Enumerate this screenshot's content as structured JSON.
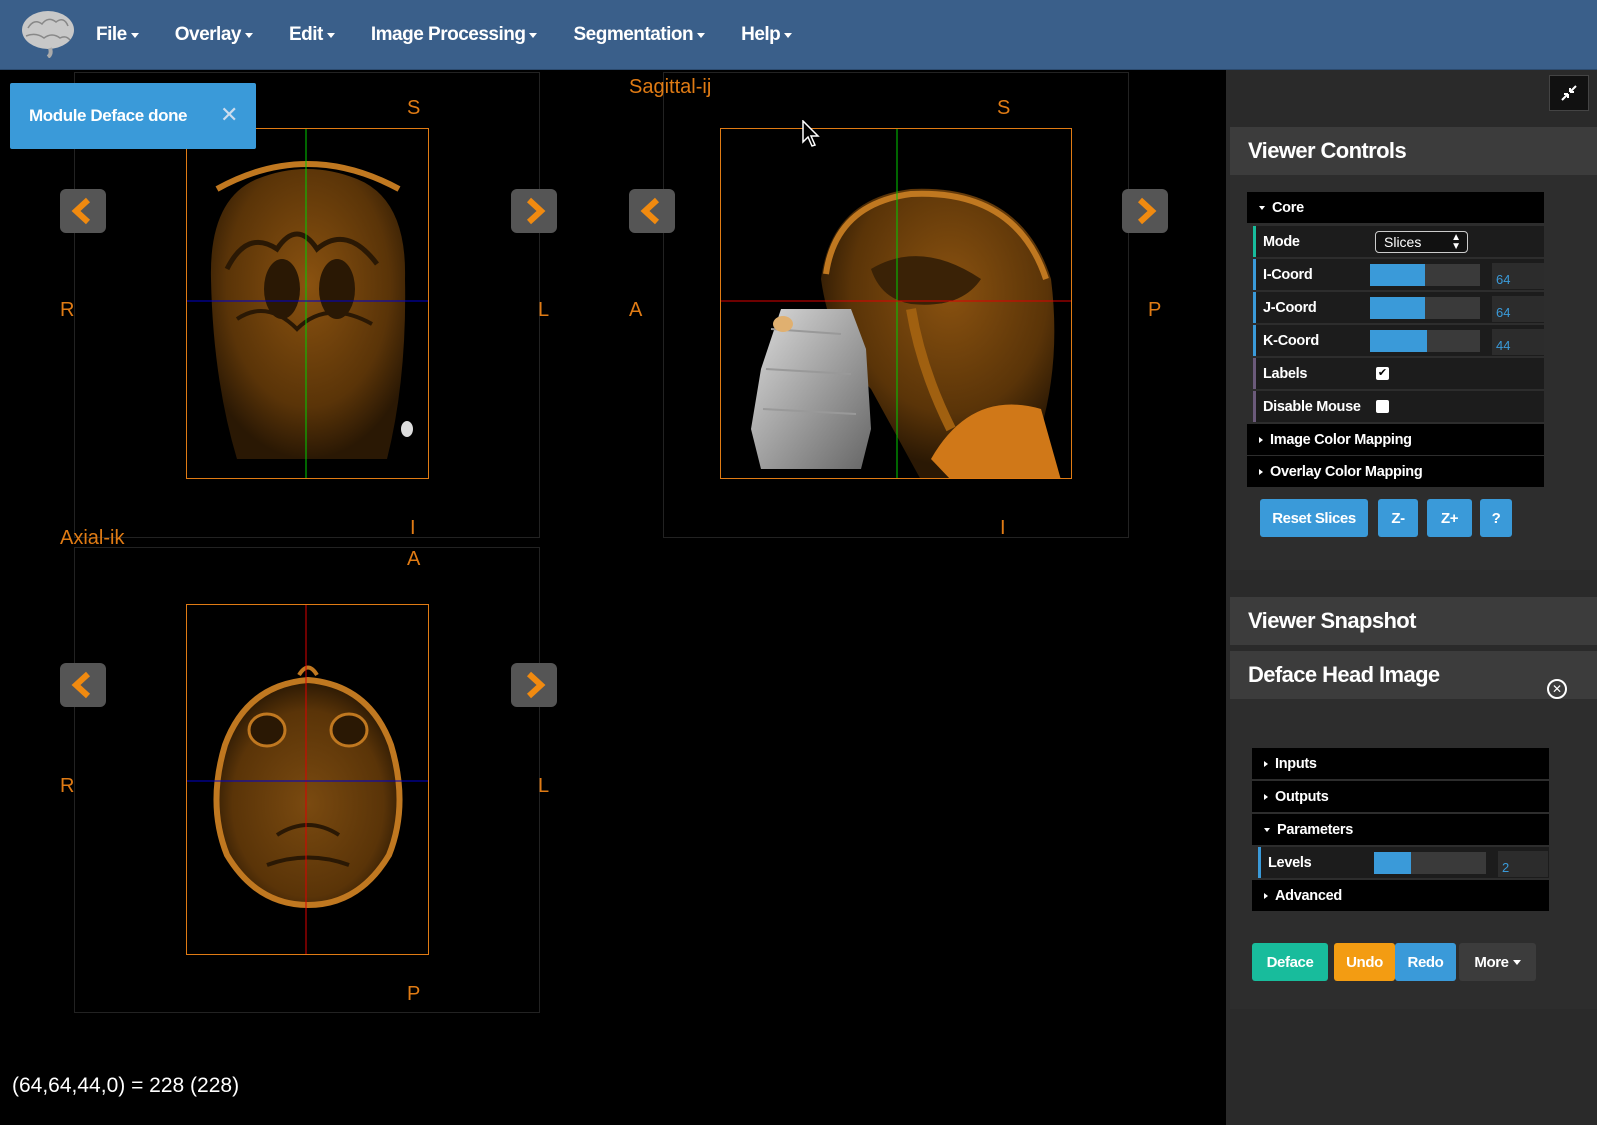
{
  "nav": {
    "logo_icon": "brain-icon",
    "menus": [
      {
        "label": "File"
      },
      {
        "label": "Overlay"
      },
      {
        "label": "Edit"
      },
      {
        "label": "Image Processing"
      },
      {
        "label": "Segmentation"
      },
      {
        "label": "Help"
      }
    ]
  },
  "toast": {
    "message": "Module Deface done",
    "close_label": "✕"
  },
  "views": {
    "coronal": {
      "label": "",
      "top": "S",
      "bottom": "I",
      "left": "R",
      "right": "L"
    },
    "sagittal": {
      "label": "Sagittal-ij",
      "top": "S",
      "bottom": "I",
      "left": "A",
      "right": "P"
    },
    "axial": {
      "label": "Axial-ik",
      "top": "A",
      "bottom": "P",
      "left": "R",
      "right": "L"
    }
  },
  "coord_readout": "(64,64,44,0) = 228 (228)",
  "viewer_controls": {
    "title": "Viewer Controls",
    "core_label": "Core",
    "mode": {
      "label": "Mode",
      "value": "Slices"
    },
    "i_coord": {
      "label": "I-Coord",
      "value": "64",
      "fraction": 0.5
    },
    "j_coord": {
      "label": "J-Coord",
      "value": "64",
      "fraction": 0.5
    },
    "k_coord": {
      "label": "K-Coord",
      "value": "44",
      "fraction": 0.52
    },
    "labels": {
      "label": "Labels",
      "checked": true
    },
    "disable_mouse": {
      "label": "Disable Mouse",
      "checked": false
    },
    "image_color_mapping": "Image Color Mapping",
    "overlay_color_mapping": "Overlay Color Mapping",
    "buttons": {
      "reset": "Reset Slices",
      "z_minus": "Z-",
      "z_plus": "Z+",
      "help": "?"
    }
  },
  "snapshot": {
    "title": "Viewer Snapshot"
  },
  "deface": {
    "title": "Deface Head Image",
    "inputs": "Inputs",
    "outputs": "Outputs",
    "parameters": "Parameters",
    "levels": {
      "label": "Levels",
      "value": "2",
      "fraction": 0.33
    },
    "advanced": "Advanced",
    "buttons": {
      "deface": "Deface",
      "undo": "Undo",
      "redo": "Redo",
      "more": "More"
    }
  },
  "colors": {
    "accent_orange": "#e07b14",
    "nav_blue": "#3a5f8a",
    "primary_blue": "#3a9ad9",
    "success_green": "#18bc9c",
    "warning_orange": "#f39c12"
  }
}
